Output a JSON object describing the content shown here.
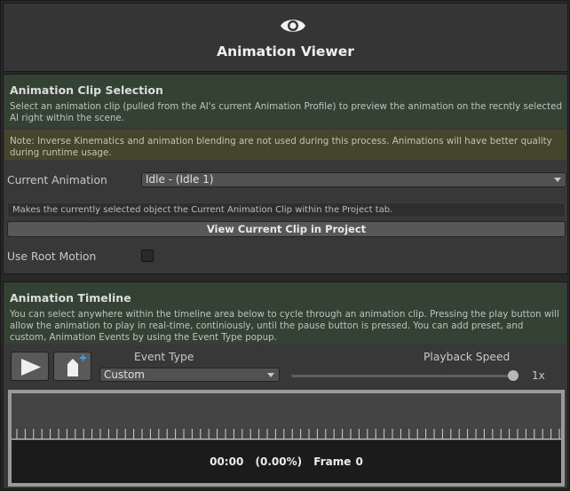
{
  "header": {
    "icon": "eye-icon",
    "title": "Animation Viewer"
  },
  "clip_selection": {
    "title": "Animation Clip Selection",
    "description": "Select an animation clip (pulled from the AI's current Animation Profile) to preview the animation on the recntly selected AI right within the scene.",
    "note": "Note: Inverse Kinematics and animation blending are not used during this process. Animations will have better quality during runtime usage.",
    "current_animation_label": "Current Animation",
    "current_animation_value": "Idle - (Idle 1)",
    "info_text": "Makes the currently selected object the Current Animation Clip within the Project tab.",
    "view_clip_button": "View Current Clip in Project",
    "root_motion_label": "Use Root Motion",
    "root_motion_checked": false
  },
  "timeline": {
    "title": "Animation Timeline",
    "description": "You can select anywhere within the timeline area below to cycle through an animation clip. Pressing the play button will allow the animation to play in real-time, continiously, until the pause button is pressed. You can add preset, and custom, Animation Events by using the Event Type popup.",
    "play_icon": "play-icon",
    "add_event_icon": "add-event-icon",
    "event_type_label": "Event Type",
    "event_type_value": "Custom",
    "playback_speed_label": "Playback Speed",
    "playback_speed_value": "1x",
    "playback_speed_fraction": 1.0,
    "time": "00:00",
    "percent": "(0.00%)",
    "frame": "Frame 0"
  }
}
